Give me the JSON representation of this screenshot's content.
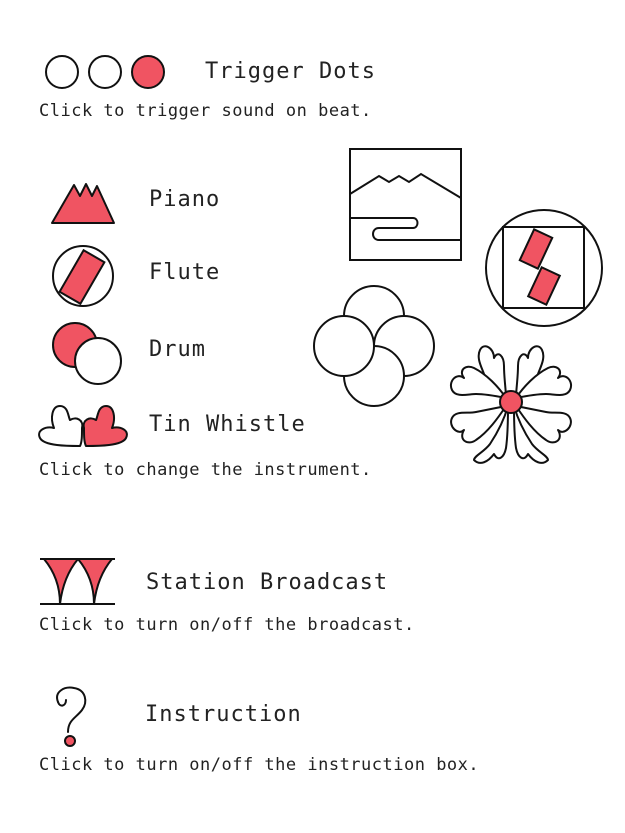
{
  "colors": {
    "accent": "#f05462",
    "stroke": "#111111",
    "fill": "#ffffff"
  },
  "trigger": {
    "label": "Trigger Dots",
    "desc": "Click to trigger sound on beat.",
    "dots": [
      {
        "icon": "empty-dot-icon"
      },
      {
        "icon": "empty-dot-icon"
      },
      {
        "icon": "filled-dot-icon"
      }
    ]
  },
  "instruments": {
    "desc": "Click to change the instrument.",
    "items": [
      {
        "label": "Piano",
        "icon": "mountain-icon"
      },
      {
        "label": "Flute",
        "icon": "circle-rectangle-icon"
      },
      {
        "label": "Drum",
        "icon": "overlapping-circles-icon"
      },
      {
        "label": "Tin Whistle",
        "icon": "petal-icon"
      }
    ]
  },
  "broadcast": {
    "label": "Station Broadcast",
    "desc": "Click to turn on/off the broadcast."
  },
  "instruction": {
    "label": "Instruction",
    "desc": "Click to turn on/off the instruction box."
  }
}
